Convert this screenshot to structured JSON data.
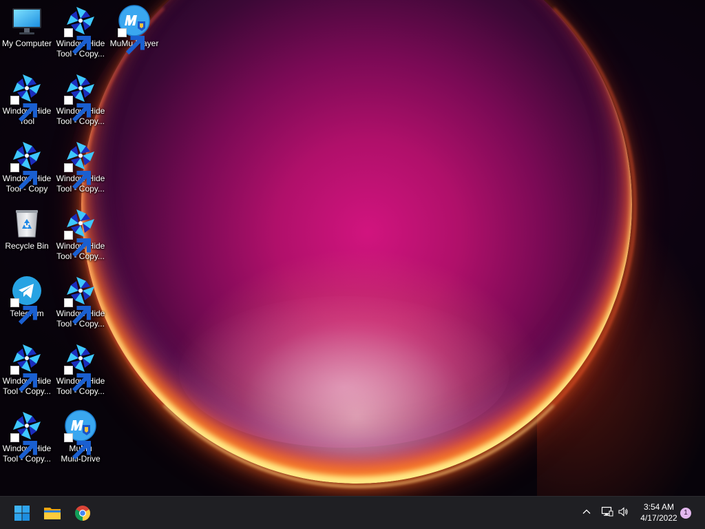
{
  "desktop": {
    "icons": [
      {
        "label": "My Computer",
        "icon": "monitor-icon"
      },
      {
        "label": "Window Hide\nTool - Copy...",
        "icon": "window-hide-tool-icon"
      },
      {
        "label": "MuMu Player",
        "icon": "mumu-player-icon"
      },
      {
        "label": "Window Hide\nTool",
        "icon": "window-hide-tool-icon"
      },
      {
        "label": "Window Hide\nTool - Copy...",
        "icon": "window-hide-tool-icon"
      },
      {
        "label": "Window Hide\nTool - Copy",
        "icon": "window-hide-tool-icon"
      },
      {
        "label": "Window Hide\nTool - Copy...",
        "icon": "window-hide-tool-icon"
      },
      {
        "label": "Recycle Bin",
        "icon": "recycle-bin-icon"
      },
      {
        "label": "Window Hide\nTool - Copy...",
        "icon": "window-hide-tool-icon"
      },
      {
        "label": "Telegram",
        "icon": "telegram-icon"
      },
      {
        "label": "Window Hide\nTool - Copy...",
        "icon": "window-hide-tool-icon"
      },
      {
        "label": "Window Hide\nTool - Copy...",
        "icon": "window-hide-tool-icon"
      },
      {
        "label": "Window Hide\nTool - Copy...",
        "icon": "window-hide-tool-icon"
      },
      {
        "label": "Window Hide\nTool - Copy...",
        "icon": "window-hide-tool-icon"
      },
      {
        "label": "MuMu\nMulti-Drive",
        "icon": "mumu-multi-drive-icon"
      }
    ]
  },
  "taskbar": {
    "pinned": [
      {
        "icon": "windows-start-icon"
      },
      {
        "icon": "file-explorer-icon"
      },
      {
        "icon": "chrome-icon"
      }
    ],
    "tray": {
      "overflow_icon": "chevron-up-icon",
      "network_icon": "network-icon",
      "volume_icon": "speaker-icon",
      "time": "3:54 AM",
      "date": "4/17/2022",
      "notification_count": "1"
    }
  },
  "colors": {
    "taskbar_bg": "#1f1f23",
    "badge_bg": "#e2b7ee",
    "orb_core": "#d1147e",
    "orb_rim": "#ffb040"
  }
}
